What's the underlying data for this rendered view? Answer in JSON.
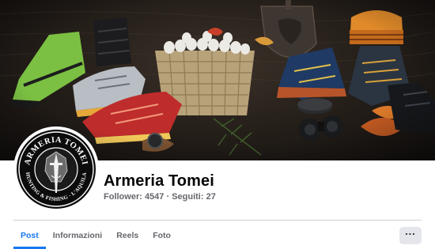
{
  "page": {
    "name": "Armeria Tomei",
    "stats_text": "Follower: 4547 · Seguiti: 27"
  },
  "logo": {
    "top_text": "ARMERIA TOMEI",
    "bottom_text": "HUNTING & FISHING · L'AQUILA"
  },
  "tabs": [
    {
      "label": "Post",
      "active": true
    },
    {
      "label": "Informazioni",
      "active": false
    },
    {
      "label": "Reels",
      "active": false
    },
    {
      "label": "Foto",
      "active": false
    }
  ],
  "more_button": {
    "label": "···",
    "icon": "more-horizontal-icon"
  },
  "colors": {
    "accent": "#1877f2",
    "text_primary": "#050505",
    "text_secondary": "#65676b",
    "divider": "#ced0d4",
    "button_bg": "#e4e6eb"
  }
}
